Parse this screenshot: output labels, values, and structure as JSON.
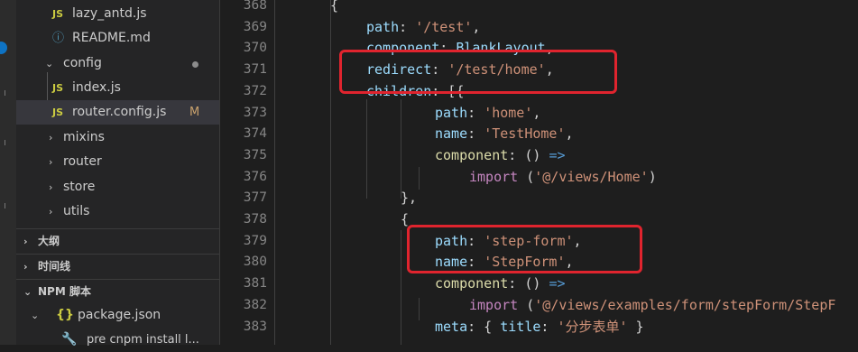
{
  "sidebar": {
    "files": [
      {
        "name": "lazy_antd.js",
        "icon": "js-file-icon"
      },
      {
        "name": "README.md",
        "icon": "info-icon"
      }
    ],
    "config_folder": "config",
    "config_files": [
      {
        "name": "index.js"
      },
      {
        "name": "router.config.js",
        "badge": "M"
      }
    ],
    "folders": [
      "mixins",
      "router",
      "store",
      "utils"
    ],
    "sections": [
      "大纲",
      "时间线",
      "NPM 脚本"
    ],
    "npm_package": "package.json",
    "npm_script": "pre  cnpm install l..."
  },
  "editor": {
    "line_numbers": [
      "368",
      "369",
      "370",
      "371",
      "372",
      "373",
      "374",
      "375",
      "376",
      "377",
      "378",
      "379",
      "380",
      "381",
      "382",
      "383"
    ],
    "highlight_color": "#e0242e"
  }
}
